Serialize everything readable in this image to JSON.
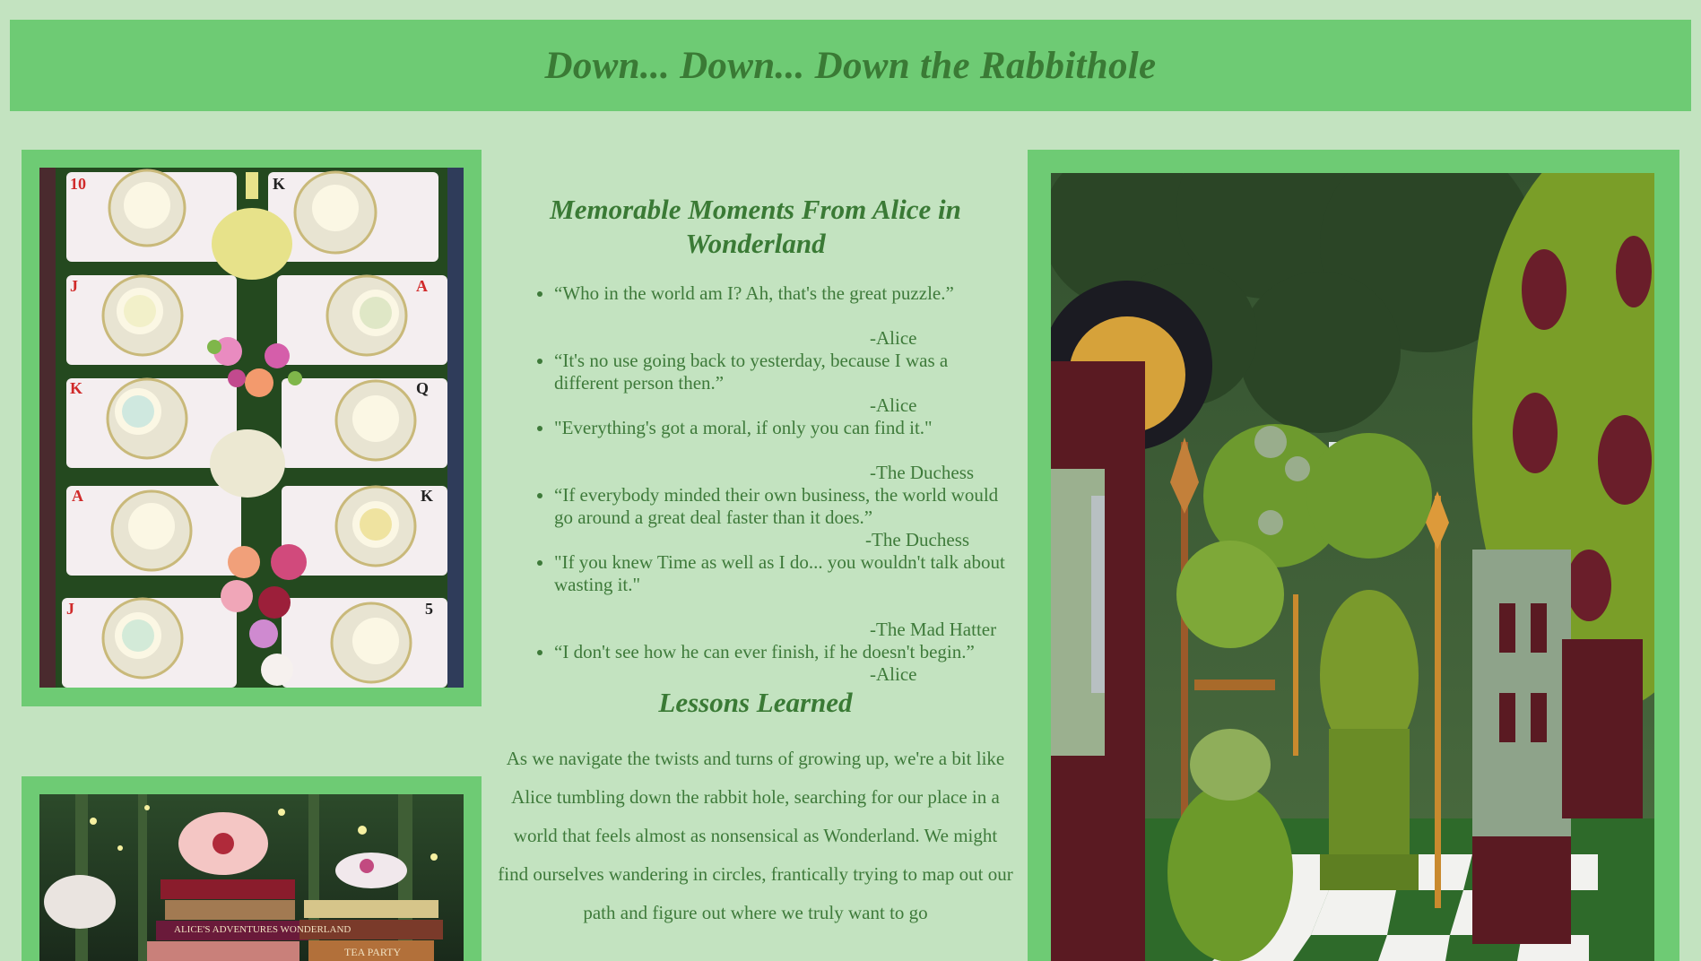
{
  "header": {
    "title": "Down... Down... Down the Rabbithole"
  },
  "moments": {
    "title": "Memorable Moments From Alice in Wonderland",
    "quotes": [
      {
        "text": "“Who in the world am I? Ah, that's the great puzzle.”",
        "author": "-Alice"
      },
      {
        "text": "“It's no use going back to yesterday, because I was a different person then.”",
        "author": "-Alice"
      },
      {
        "text": "\"Everything's got a moral, if only you can find it.\"",
        "author": "-The Duchess"
      },
      {
        "text": "“If everybody minded their own business, the world would go around a great deal faster than it does.”",
        "author": "-The Duchess"
      },
      {
        "text": "\"If you knew Time as well as I do... you wouldn't talk about wasting it.\"",
        "author": "-The Mad Hatter"
      },
      {
        "text": "“I don't see how he can ever finish, if he doesn't begin.”",
        "author": "-Alice"
      }
    ]
  },
  "lessons": {
    "title": "Lessons Learned",
    "paragraph": "As we navigate the twists and turns of growing up, we're a bit like Alice tumbling down the rabbit hole, searching for our place in a world that feels almost as nonsensical as Wonderland. We might find ourselves wandering in circles, frantically trying to map out our path and figure out where we truly want to go"
  },
  "images": {
    "tea_cards": "tea-party-playing-cards-photo",
    "teapots_books": "teapots-and-books-forest-photo",
    "topiary": "topiary-chess-garden-photo"
  },
  "book_titles": [
    "ALICE'S ADVENTURES WONDERLAND",
    "TEA PARTY"
  ],
  "colors": {
    "background": "#c3e3c0",
    "frame": "#6ecb74",
    "text": "#3e7a3a"
  }
}
